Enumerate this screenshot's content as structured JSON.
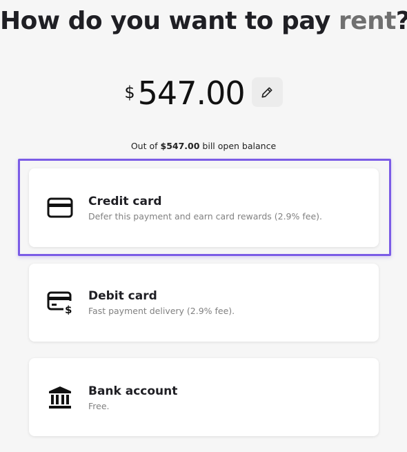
{
  "header": {
    "title_main": "How do you want to pay ",
    "title_accent": "rent",
    "title_end": "?"
  },
  "payment": {
    "currency_symbol": "$",
    "amount": "547.00",
    "balance_prefix": "Out of ",
    "balance_amount": "$547.00",
    "balance_suffix": " bill open balance"
  },
  "methods": [
    {
      "label": "Credit card",
      "description": "Defer this payment and earn card rewards (2.9% fee).",
      "icon": "credit-card-icon",
      "selected": true
    },
    {
      "label": "Debit card",
      "description": "Fast payment delivery (2.9% fee).",
      "icon": "debit-card-icon",
      "selected": false
    },
    {
      "label": "Bank account",
      "description": "Free.",
      "icon": "bank-icon",
      "selected": false
    }
  ],
  "colors": {
    "selection_outline": "#7b5ce6",
    "title_accent": "#707070",
    "background": "#f6f6f6"
  }
}
